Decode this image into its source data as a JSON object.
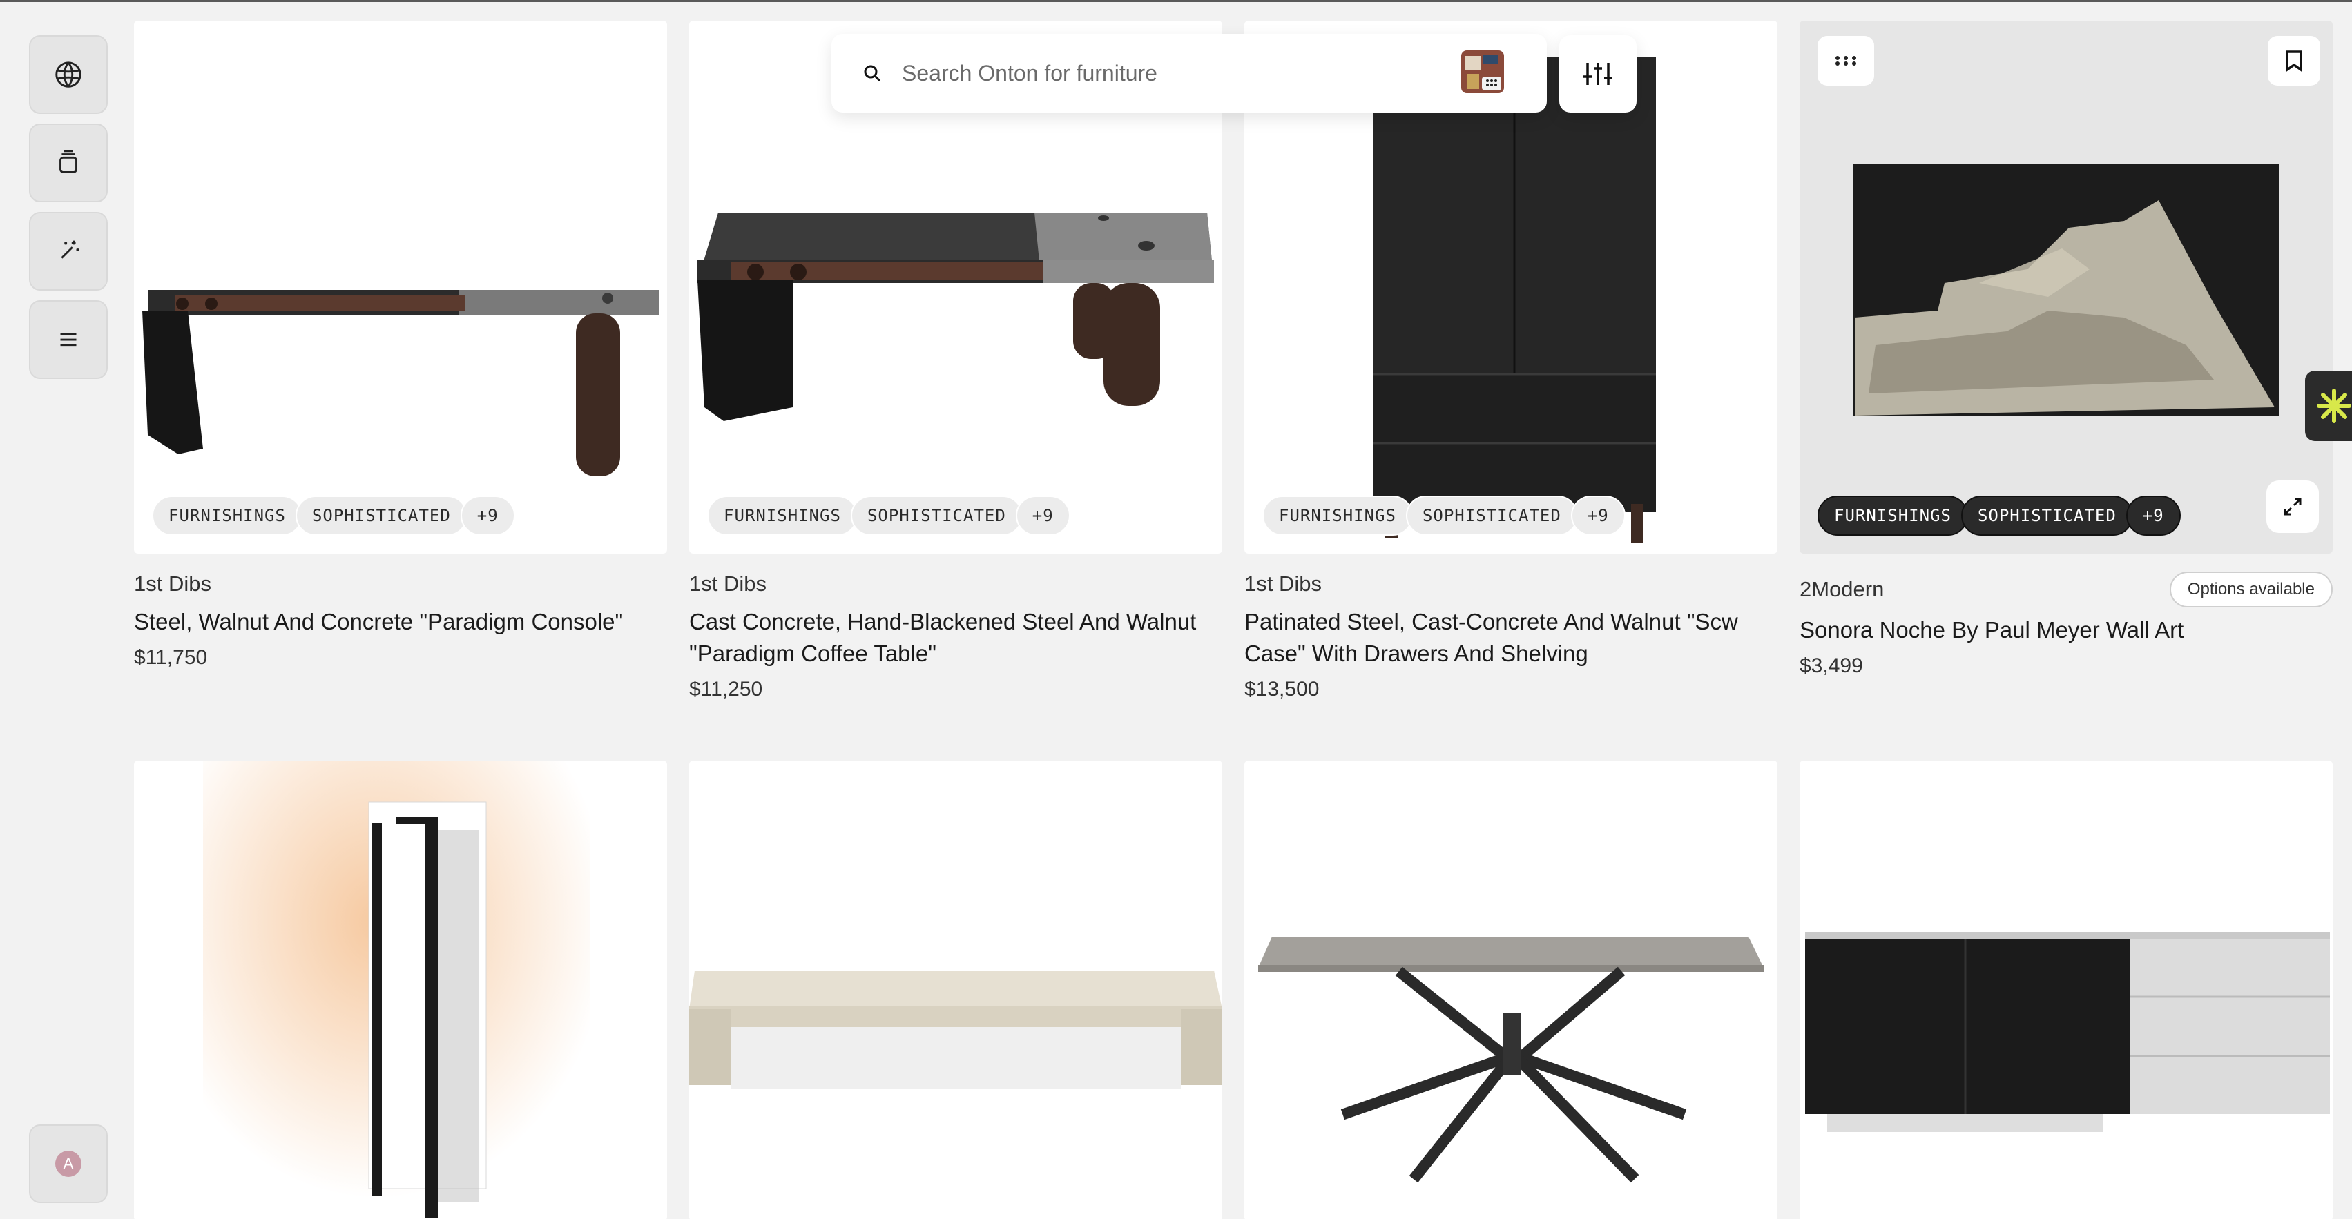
{
  "search": {
    "placeholder": "Search Onton for furniture"
  },
  "sidebar": {
    "items": [
      {
        "icon": "globe-icon"
      },
      {
        "icon": "stack-icon"
      },
      {
        "icon": "magic-wand-icon"
      },
      {
        "icon": "menu-icon"
      }
    ],
    "avatar_initial": "A"
  },
  "tag_labels": [
    "FURNISHINGS",
    "SOPHISTICATED",
    "+9"
  ],
  "products": [
    {
      "brand": "1st Dibs",
      "title": "Steel, Walnut And Concrete \"Paradigm Console\"",
      "price": "$11,750"
    },
    {
      "brand": "1st Dibs",
      "title": "Cast Concrete, Hand-Blackened Steel And Walnut \"Paradigm Coffee Table\"",
      "price": "$11,250"
    },
    {
      "brand": "1st Dibs",
      "title": "Patinated Steel, Cast-Concrete And Walnut \"Scw Case\" With Drawers And Shelving",
      "price": "$13,500"
    },
    {
      "brand": "2Modern",
      "title": "Sonora Noche By Paul Meyer Wall Art",
      "price": "$3,499",
      "badge": "Options available"
    }
  ],
  "colors": {
    "accent_star": "#d8e84a",
    "background": "#f2f2f2",
    "dark_pill": "#2a2a2a"
  }
}
